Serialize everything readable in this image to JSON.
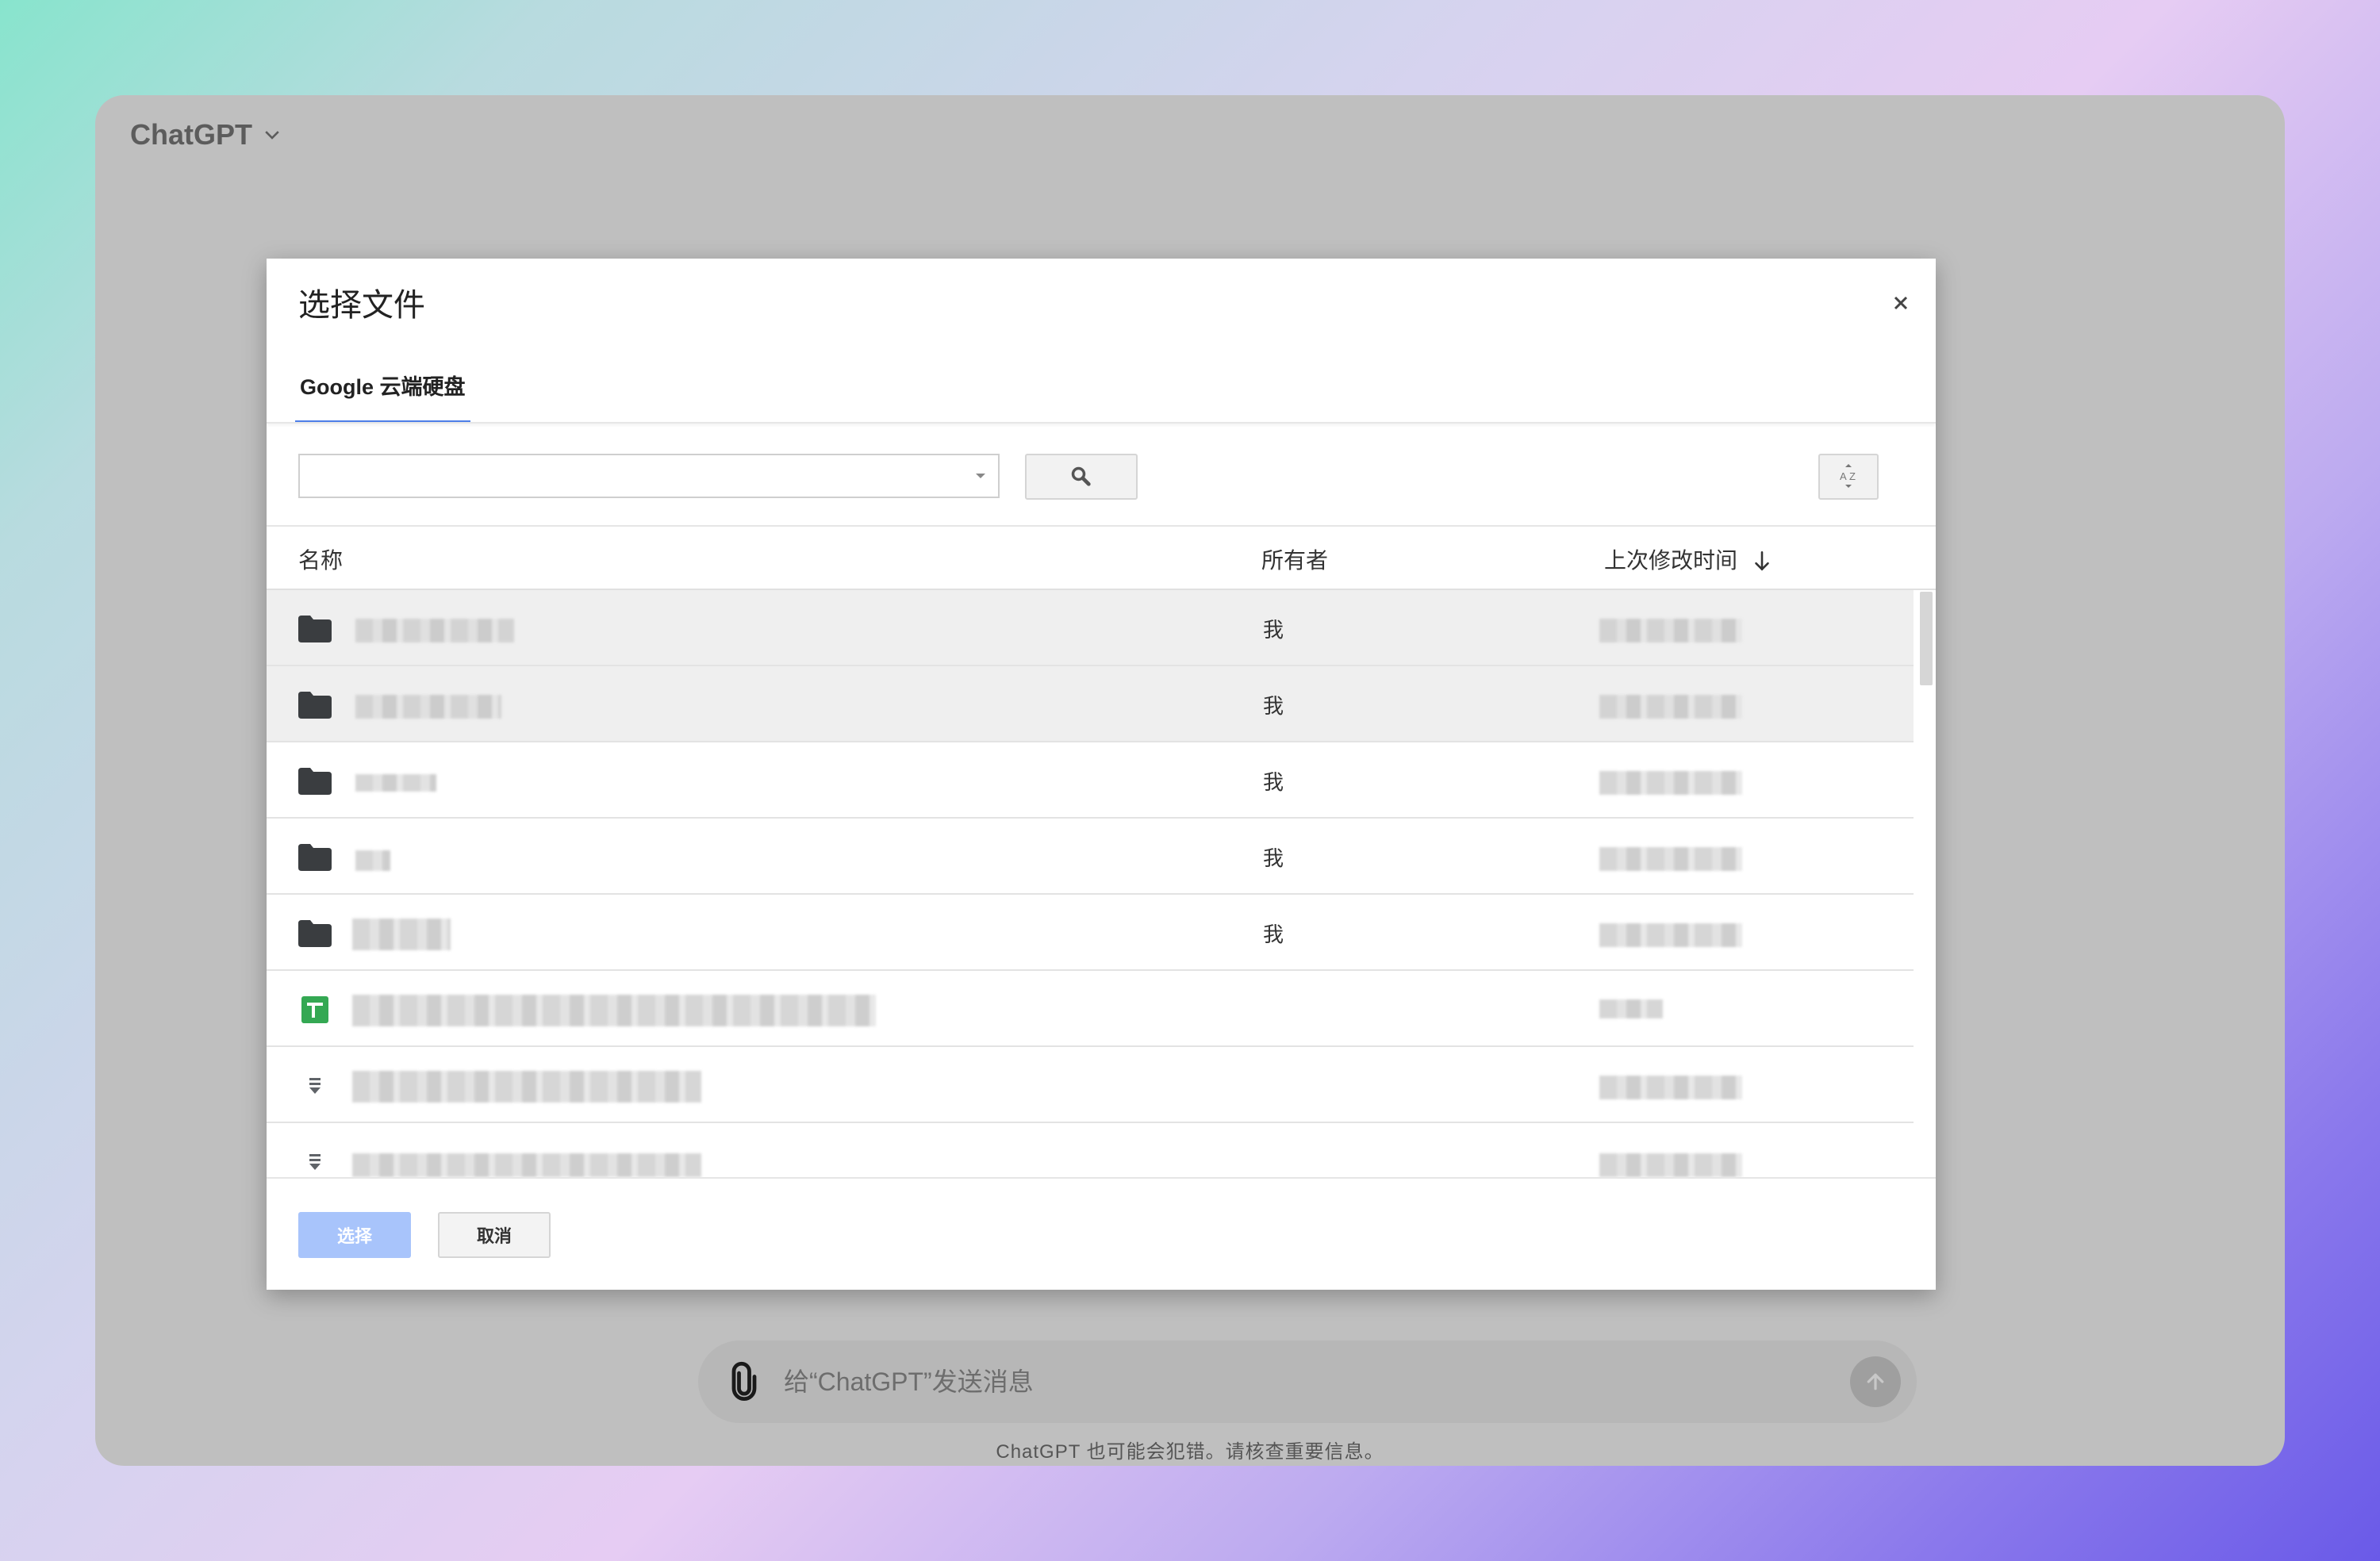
{
  "app": {
    "title": "ChatGPT",
    "composer_placeholder": "给“ChatGPT”发送消息",
    "disclaimer": "ChatGPT 也可能会犯错。请核查重要信息。"
  },
  "dialog": {
    "title": "选择文件",
    "tab_label": "Google 云端硬盘",
    "columns": {
      "name": "名称",
      "owner": "所有者",
      "modified": "上次修改时间"
    },
    "rows": [
      {
        "icon": "folder-icon",
        "owner": "我",
        "selected": true
      },
      {
        "icon": "folder-icon",
        "owner": "我",
        "selected": true
      },
      {
        "icon": "folder-icon",
        "owner": "我",
        "selected": false
      },
      {
        "icon": "folder-icon",
        "owner": "我",
        "selected": false
      },
      {
        "icon": "folder-icon",
        "owner": "我",
        "selected": false
      },
      {
        "icon": "spreadsheet-icon",
        "owner": "",
        "selected": false
      },
      {
        "icon": "document-icon",
        "owner": "",
        "selected": false
      },
      {
        "icon": "document-icon",
        "owner": "",
        "selected": false
      }
    ],
    "select_label": "选择",
    "cancel_label": "取消"
  },
  "colors": {
    "accent": "#4d7fe8",
    "select_button": "#a8c4fb",
    "sheets_green": "#34a853",
    "overlay": "#bfbfbf"
  }
}
